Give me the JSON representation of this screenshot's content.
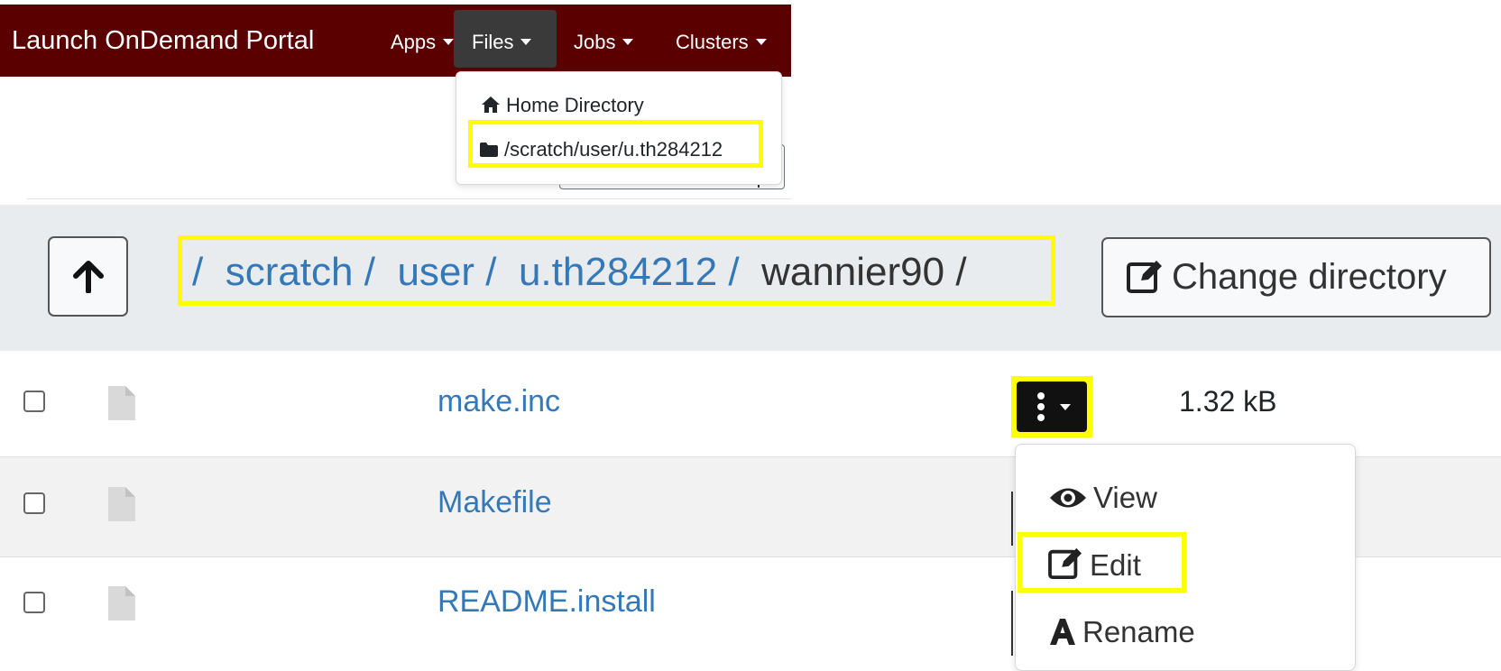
{
  "navbar": {
    "brand": "Launch OnDemand Portal",
    "items": [
      {
        "label": "Apps"
      },
      {
        "label": "Files"
      },
      {
        "label": "Jobs"
      },
      {
        "label": "Clusters"
      }
    ],
    "background": "#5b0000"
  },
  "files_menu": {
    "items": [
      {
        "label": "Home Directory",
        "icon": "home-icon"
      },
      {
        "label": "/scratch/user/u.th284212",
        "icon": "folder-icon",
        "highlighted": true
      }
    ]
  },
  "breadcrumb": {
    "root": "/",
    "parts": [
      "scratch",
      "user",
      "u.th284212",
      "wannier90"
    ],
    "separator": "/"
  },
  "toolbar": {
    "change_directory_label": "Change directory"
  },
  "files": [
    {
      "name": "make.inc",
      "size": "1.32 kB"
    },
    {
      "name": "Makefile"
    },
    {
      "name": "README.install"
    }
  ],
  "row_actions_menu": {
    "items": [
      {
        "label": "View",
        "icon": "eye-icon"
      },
      {
        "label": "Edit",
        "icon": "edit-icon",
        "highlighted": true
      },
      {
        "label": "Rename",
        "icon": "rename-icon"
      }
    ]
  },
  "colors": {
    "link": "#3478b8",
    "highlight": "#ffff00",
    "breadcrumb_bg": "#e9ecef"
  }
}
